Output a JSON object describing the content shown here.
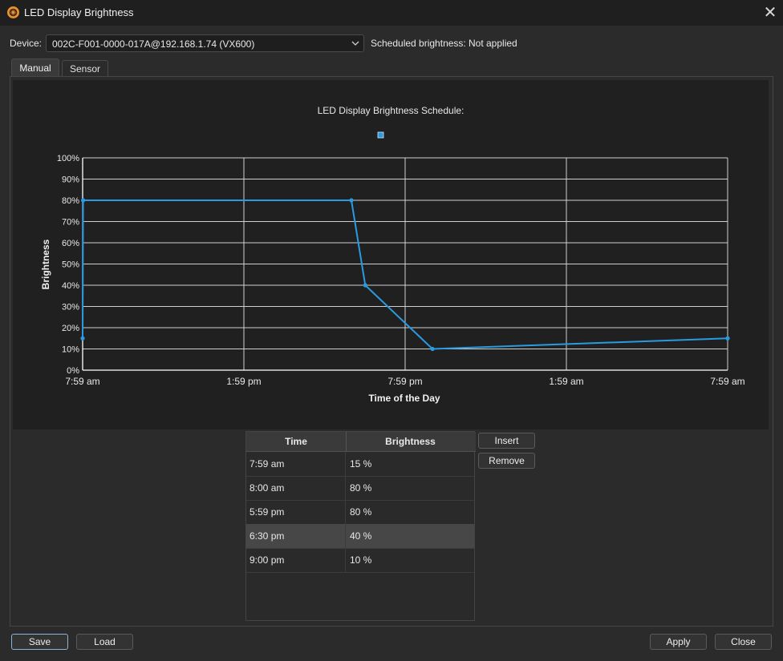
{
  "window": {
    "title": "LED Display Brightness",
    "close_glyph": "✕"
  },
  "device": {
    "label": "Device:",
    "value": "002C-F001-0000-017A@192.168.1.74 (VX600)"
  },
  "scheduled": {
    "label": "Scheduled brightness:",
    "value": "Not applied"
  },
  "tabs": [
    {
      "label": "Manual"
    },
    {
      "label": "Sensor"
    }
  ],
  "chart_data": {
    "type": "line",
    "title": "LED Display Brightness Schedule:",
    "xlabel": "Time of the Day",
    "ylabel": "Brightness",
    "x_ticks": [
      "7:59 am",
      "1:59 pm",
      "7:59 pm",
      "1:59 am",
      "7:59 am"
    ],
    "y_ticks": [
      "0%",
      "10%",
      "20%",
      "30%",
      "40%",
      "50%",
      "60%",
      "70%",
      "80%",
      "90%",
      "100%"
    ],
    "xlim": [
      "7:59 am",
      "7:59 am (+1 day)"
    ],
    "ylim": [
      0,
      100
    ],
    "grid": true,
    "legend": "top-center",
    "color": "#2a9be0",
    "series": [
      {
        "x": [
          "7:59 am",
          "8:00 am",
          "5:59 pm",
          "6:30 pm",
          "9:00 pm",
          "7:59 am"
        ],
        "x_minutes": [
          479,
          480,
          1079,
          1110,
          1260,
          1919
        ],
        "values": [
          15,
          80,
          80,
          40,
          10,
          15
        ]
      }
    ]
  },
  "table": {
    "headers": [
      "Time",
      "Brightness"
    ],
    "rows": [
      {
        "time": "7:59 am",
        "brightness": "15 %"
      },
      {
        "time": "8:00 am",
        "brightness": "80 %"
      },
      {
        "time": "5:59 pm",
        "brightness": "80 %"
      },
      {
        "time": "6:30 pm",
        "brightness": "40 %"
      },
      {
        "time": "9:00 pm",
        "brightness": "10 %"
      }
    ],
    "selected_row": 3
  },
  "buttons": {
    "insert": "Insert",
    "remove": "Remove",
    "save": "Save",
    "load": "Load",
    "apply": "Apply",
    "close": "Close"
  }
}
